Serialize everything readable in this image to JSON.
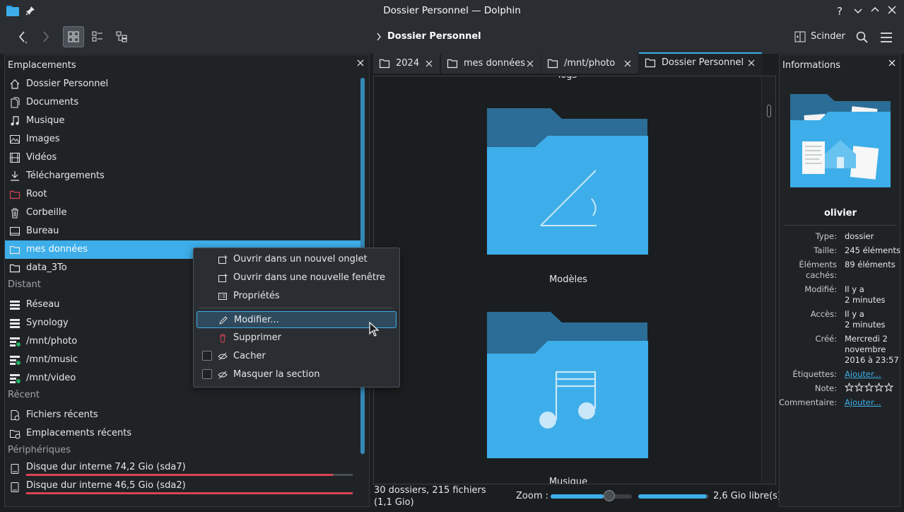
{
  "window": {
    "title": "Dossier Personnel — Dolphin"
  },
  "toolbar": {
    "breadcrumb": "Dossier Personnel",
    "split_label": "Scinder"
  },
  "places": {
    "title": "Emplacements",
    "items": [
      {
        "label": "Dossier Personnel",
        "icon": "home-icon"
      },
      {
        "label": "Documents",
        "icon": "documents-icon"
      },
      {
        "label": "Musique",
        "icon": "music-icon"
      },
      {
        "label": "Images",
        "icon": "images-icon"
      },
      {
        "label": "Vidéos",
        "icon": "videos-icon"
      },
      {
        "label": "Téléchargements",
        "icon": "download-icon"
      },
      {
        "label": "Root",
        "icon": "root-folder-icon"
      },
      {
        "label": "Corbeille",
        "icon": "trash-icon"
      },
      {
        "label": "Bureau",
        "icon": "desktop-icon"
      },
      {
        "label": "mes données",
        "icon": "folder-icon",
        "selected": true
      },
      {
        "label": "data_3To",
        "icon": "folder-icon"
      }
    ],
    "remote_title": "Distant",
    "remote": [
      {
        "label": "Réseau",
        "icon": "network-icon"
      },
      {
        "label": "Synology",
        "icon": "server-icon"
      },
      {
        "label": "/mnt/photo",
        "icon": "network-share-icon"
      },
      {
        "label": "/mnt/music",
        "icon": "network-share-icon"
      },
      {
        "label": "/mnt/video",
        "icon": "network-share-icon"
      }
    ],
    "recent_title": "Récent",
    "recent": [
      {
        "label": "Fichiers récents",
        "icon": "recent-files-icon"
      },
      {
        "label": "Emplacements récents",
        "icon": "recent-places-icon"
      }
    ],
    "devices_title": "Périphériques",
    "devices": [
      {
        "label": "Disque dur interne 74,2 Gio (sda7)",
        "icon": "drive-icon",
        "usage": 0.94
      },
      {
        "label": "Disque dur interne 46,5 Gio (sda2)",
        "icon": "drive-icon",
        "usage": 1.0
      }
    ]
  },
  "tabs": [
    {
      "label": "2024"
    },
    {
      "label": "mes données"
    },
    {
      "label": "/mnt/photo"
    },
    {
      "label": "Dossier Personnel",
      "active": true
    }
  ],
  "view": {
    "top_partial_label": "logs",
    "folders": [
      {
        "label": "Modèles",
        "emblem": "templates-emblem"
      },
      {
        "label": "Musique",
        "emblem": "music-emblem"
      }
    ]
  },
  "status": {
    "summary_line1": "30 dossiers, 215 fichiers",
    "summary_line2": "(1,1 Gio)",
    "zoom_label": "Zoom :",
    "free_space": "2,6 Gio libre(s)",
    "zoom_level": 0.65,
    "disk_used": 0.97
  },
  "info": {
    "title": "Informations",
    "name": "olivier",
    "rows": [
      {
        "key": "Type:",
        "value": "dossier"
      },
      {
        "key": "Taille:",
        "value": "245 éléments"
      },
      {
        "key": "Éléments\ncachés:",
        "value": "89 éléments"
      },
      {
        "key": "Modifié:",
        "value": "Il y a\n2 minutes"
      },
      {
        "key": "Accès:",
        "value": "Il y a\n2 minutes"
      },
      {
        "key": "Créé:",
        "value": "Mercredi 2\nnovembre\n2016 à 23:57"
      },
      {
        "key": "Étiquettes:",
        "value": "Ajouter...",
        "link": true
      },
      {
        "key": "Note:",
        "value": "",
        "rating": 0
      },
      {
        "key": "Commentaire:",
        "value": "Ajouter...",
        "link": true
      }
    ]
  },
  "context_menu": {
    "items": [
      {
        "label": "Ouvrir dans un nouvel onglet",
        "icon": "new-tab-icon"
      },
      {
        "label": "Ouvrir dans une nouvelle fenêtre",
        "icon": "new-window-icon"
      },
      {
        "label": "Propriétés",
        "icon": "properties-icon"
      },
      {
        "label": "Modifier...",
        "icon": "edit-icon",
        "highlighted": true
      },
      {
        "label": "Supprimer",
        "icon": "delete-icon"
      },
      {
        "label": "Cacher",
        "icon": "hide-icon",
        "checkbox": true
      },
      {
        "label": "Masquer la section",
        "icon": "hide-section-icon",
        "checkbox": true
      }
    ]
  },
  "colors": {
    "accent": "#3daee9",
    "danger": "#da4453",
    "background": "#1b1e20"
  }
}
